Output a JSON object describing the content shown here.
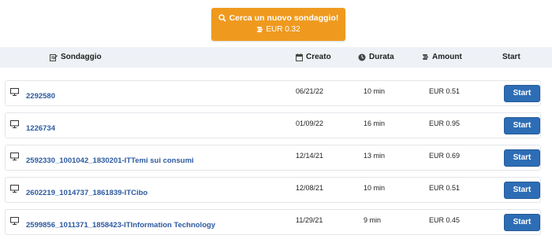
{
  "cta": {
    "label": "Cerca un nuovo sondaggio!",
    "amount": "EUR 0.32",
    "color": "#ef9a1f"
  },
  "header": {
    "survey": "Sondaggio",
    "created": "Creato",
    "duration": "Durata",
    "amount": "Amount",
    "start": "Start"
  },
  "rows": [
    {
      "name": "2292580",
      "created": "06/21/22",
      "duration": "10 min",
      "amount": "EUR 0.51",
      "button": "Start"
    },
    {
      "name": "1226734",
      "created": "01/09/22",
      "duration": "16 min",
      "amount": "EUR 0.95",
      "button": "Start"
    },
    {
      "name": "2592330_1001042_1830201-ITTemi sui consumi",
      "created": "12/14/21",
      "duration": "13 min",
      "amount": "EUR 0.69",
      "button": "Start"
    },
    {
      "name": "2602219_1014737_1861839-ITCibo",
      "created": "12/08/21",
      "duration": "10 min",
      "amount": "EUR 0.51",
      "button": "Start"
    },
    {
      "name": "2599856_1011371_1858423-ITInformation Technology",
      "created": "11/29/21",
      "duration": "9 min",
      "amount": "EUR 0.45",
      "button": "Start"
    }
  ],
  "colors": {
    "accent": "#2d6db5",
    "link": "#2c5aa0",
    "header_bg": "#eef1f6"
  }
}
